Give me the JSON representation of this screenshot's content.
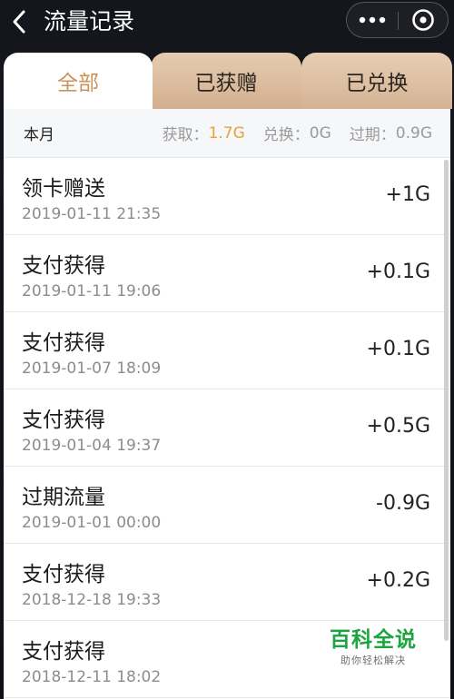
{
  "header": {
    "back_icon": "chevron-left-icon",
    "title": "流量记录",
    "more_icon": "more-dots-icon",
    "close_icon": "close-circle-icon"
  },
  "tabs": [
    {
      "label": "全部",
      "active": true
    },
    {
      "label": "已获赠",
      "active": false
    },
    {
      "label": "已兑换",
      "active": false
    }
  ],
  "summary": {
    "month": "本月",
    "obtained_label": "获取：",
    "obtained_value": "1.7G",
    "exchanged_label": "兑换：",
    "exchanged_value": "0G",
    "expired_label": "过期：",
    "expired_value": "0.9G"
  },
  "records": [
    {
      "name": "领卡赠送",
      "time": "2019-01-11 21:35",
      "amount": "+1G"
    },
    {
      "name": "支付获得",
      "time": "2019-01-11 19:06",
      "amount": "+0.1G"
    },
    {
      "name": "支付获得",
      "time": "2019-01-07 18:09",
      "amount": "+0.1G"
    },
    {
      "name": "支付获得",
      "time": "2019-01-04 19:37",
      "amount": "+0.5G"
    },
    {
      "name": "过期流量",
      "time": "2019-01-01 00:00",
      "amount": "-0.9G"
    },
    {
      "name": "支付获得",
      "time": "2018-12-18 19:33",
      "amount": "+0.2G"
    },
    {
      "name": "支付获得",
      "time": "2018-12-11 18:02",
      "amount": ""
    }
  ],
  "watermark": {
    "title": "百科全说",
    "subtitle": "助你轻松解决"
  },
  "colors": {
    "accent": "#e6a23c",
    "active_tab_text": "#c9935a",
    "watermark_green": "#1aa53f"
  }
}
